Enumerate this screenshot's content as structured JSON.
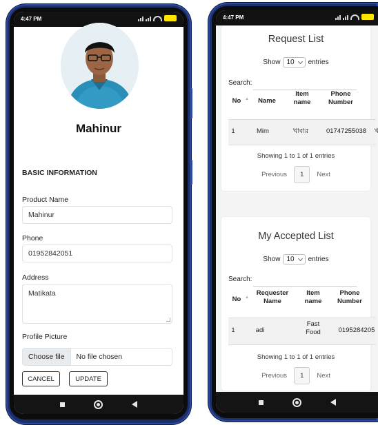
{
  "left_phone": {
    "status": {
      "time": "4:47 PM"
    },
    "profile": {
      "name": "Mahinur"
    },
    "section_title": "BASIC INFORMATION",
    "fields": {
      "product_name_label": "Product Name",
      "product_name_value": "Mahinur",
      "phone_label": "Phone",
      "phone_value": "01952842051",
      "address_label": "Address",
      "address_value": "Matikata",
      "profile_picture_label": "Profile Picture",
      "choose_file_label": "Choose file",
      "no_file_text": "No file chosen"
    },
    "buttons": {
      "cancel": "CANCEL",
      "update": "UPDATE"
    }
  },
  "right_phone": {
    "status": {
      "time": "4:47 PM"
    },
    "request_list": {
      "title": "Request List",
      "show_label": "Show",
      "entries_value": "10",
      "entries_label": "entries",
      "search_label": "Search:",
      "columns": [
        "No",
        "Name",
        "Item name",
        "Phone Number"
      ],
      "rows": [
        {
          "no": "1",
          "name": "Mim",
          "item": "খাবার",
          "phone": "01747255038",
          "extra": "খ"
        }
      ],
      "info": "Showing 1 to 1 of 1 entries",
      "pager": {
        "prev": "Previous",
        "page": "1",
        "next": "Next"
      }
    },
    "accepted_list": {
      "title": "My Accepted List",
      "show_label": "Show",
      "entries_value": "10",
      "entries_label": "entries",
      "search_label": "Search:",
      "columns": [
        "No",
        "Requester Name",
        "Item name",
        "Phone Number"
      ],
      "rows": [
        {
          "no": "1",
          "name": "adi",
          "item": "Fast Food",
          "phone": "0195284205"
        }
      ],
      "info": "Showing 1 to 1 of 1 entries",
      "pager": {
        "prev": "Previous",
        "page": "1",
        "next": "Next"
      }
    }
  },
  "colors": {
    "frame": "#1c2f6b",
    "status_bar": "#121212",
    "battery": "#ffe600",
    "band": "#f2f2f2"
  }
}
